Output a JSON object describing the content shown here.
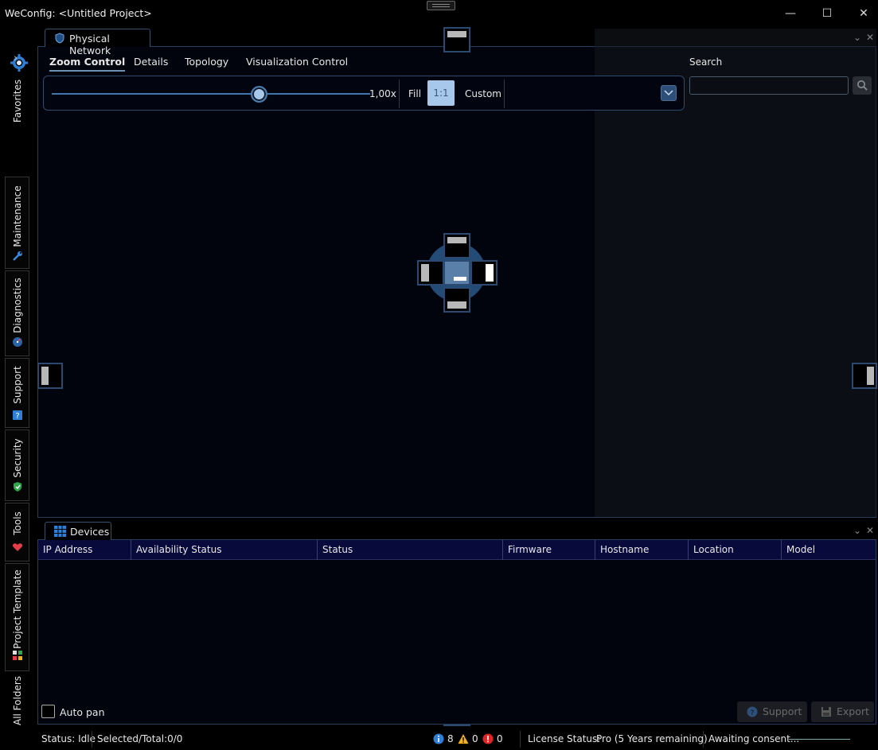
{
  "window": {
    "title": "WeConfig: <Untitled Project>",
    "minimize": "—",
    "maximize": "☐",
    "close": "✕"
  },
  "rail": {
    "expand": "›",
    "items": [
      {
        "label": "Favorites"
      },
      {
        "label": "Maintenance"
      },
      {
        "label": "Diagnostics"
      },
      {
        "label": "Support"
      },
      {
        "label": "Security"
      },
      {
        "label": "Tools"
      },
      {
        "label": "Project Template"
      },
      {
        "label": "All Folders"
      }
    ]
  },
  "document": {
    "tab_label": "Physical Network",
    "panel_tools": {
      "collapse": "⌄",
      "close": "✕"
    },
    "nav_tabs": [
      "Zoom Control",
      "Details",
      "Topology",
      "Visualization Control"
    ],
    "active_tab": "Zoom Control",
    "zoom": {
      "value_label": "1,00x",
      "level_fraction": 0.65,
      "fill": "Fill",
      "one_to_one": "1:1",
      "custom": "Custom"
    },
    "search": {
      "label": "Search",
      "value": "",
      "placeholder": ""
    }
  },
  "devices": {
    "tab_label": "Devices",
    "panel_tools": {
      "collapse": "⌄",
      "close": "✕"
    },
    "columns": [
      "IP Address",
      "Availability Status",
      "Status",
      "Firmware",
      "Hostname",
      "Location",
      "Model"
    ],
    "rows": [],
    "auto_pan": "Auto pan",
    "support": "Support",
    "export": "Export"
  },
  "status": {
    "status": "Status: Idle",
    "selected": "Selected/Total:0/0",
    "info_count": "8",
    "warning_count": "0",
    "error_count": "0",
    "license_label": "License Status:",
    "license_value": "Pro (5 Years remaining)",
    "consent": "Awaiting consent..."
  },
  "colors": {
    "accent": "#3e76b0",
    "selected": "#a7c8ea",
    "info": "#2f7fd6",
    "warning": "#f2b01e",
    "error": "#e02424"
  },
  "icons": [
    "gear-icon",
    "shield-icon",
    "wrench-icon",
    "gauge-icon",
    "help-icon",
    "security-shield-icon",
    "heart-icon",
    "template-icon",
    "grid-icon",
    "search-icon",
    "info-icon",
    "warning-icon",
    "error-icon"
  ]
}
